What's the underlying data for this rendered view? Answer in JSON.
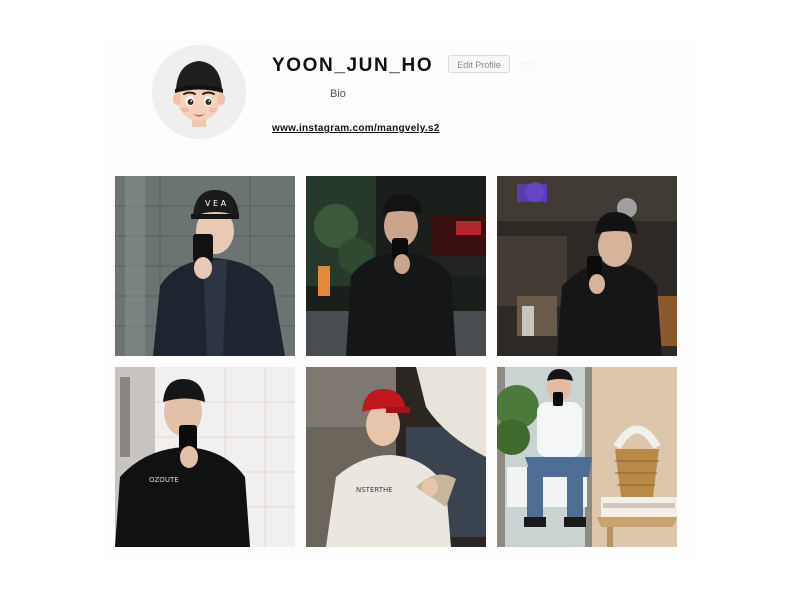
{
  "profile": {
    "username": "YOON_JUN_HO",
    "edit_label": "Edit Profile",
    "more_label": "···",
    "bio": "Bio",
    "link": "www.instagram.com/mangvely.s2"
  },
  "posts": [
    {
      "alt": "mirror selfie, navy jacket, black cap, tiled wall"
    },
    {
      "alt": "night mirror selfie, black jacket, street"
    },
    {
      "alt": "mirror selfie in dim bar with purple lights"
    },
    {
      "alt": "mirror selfie, black hoodie, white tiles"
    },
    {
      "alt": "sitting by window, red cap, grey sweatshirt"
    },
    {
      "alt": "mirror photo, sitting, rattan basket"
    }
  ],
  "colors": {
    "accent_text": "#262626",
    "border": "#dbdbdb",
    "avatar_bg": "#efefef"
  }
}
